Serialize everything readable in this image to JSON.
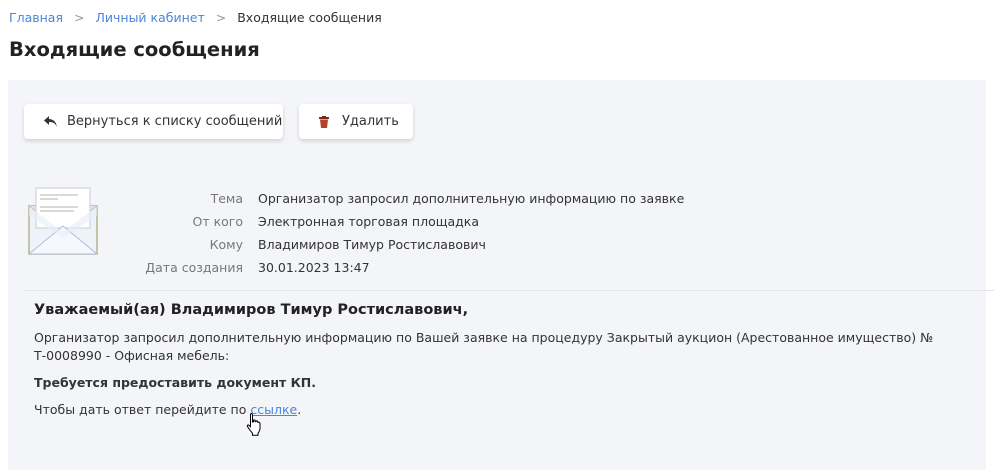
{
  "breadcrumb": [
    {
      "label": "Главная"
    },
    {
      "label": "Личный кабинет"
    },
    {
      "label": "Входящие сообщения"
    }
  ],
  "page_title": "Входящие сообщения",
  "toolbar": {
    "back_label": "Вернуться к списку сообщений",
    "delete_label": "Удалить"
  },
  "meta": [
    {
      "label": "Тема",
      "value": "Организатор запросил дополнительную информацию по заявке"
    },
    {
      "label": "От кого",
      "value": "Электронная торговая площадка"
    },
    {
      "label": "Кому",
      "value": "Владимиров Тимур Ростиславович"
    },
    {
      "label": "Дата создания",
      "value": "30.01.2023 13:47"
    }
  ],
  "message": {
    "greeting": "Уважаемый(ая) Владимиров Тимур Ростиславович,",
    "paragraph": "Организатор запросил дополнительную информацию по Вашей заявке на процедуру Закрытый аукцион (Арестованное имущество) № Т-0008990 - Офисная мебель:",
    "requirement": "Требуется предоставить документ КП.",
    "reply_prefix": "Чтобы дать ответ перейдите по ",
    "reply_link": "ссылке",
    "reply_suffix": "."
  },
  "colors": {
    "link": "#4a86d9",
    "panel": "#f4f5f9"
  }
}
